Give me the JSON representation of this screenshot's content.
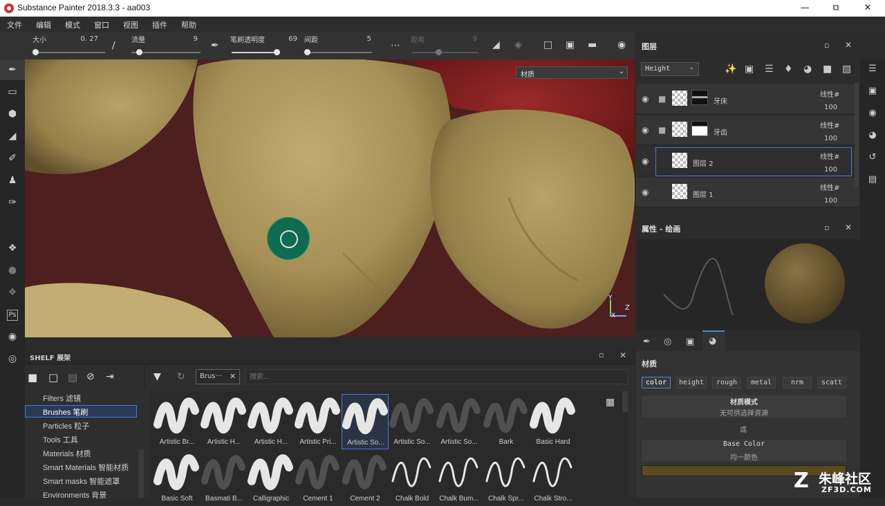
{
  "app": {
    "title": "Substance Painter 2018.3.3 - aa003",
    "window_controls": [
      "minimize-icon",
      "restore-icon",
      "close-icon"
    ]
  },
  "menu": [
    "文件",
    "编辑",
    "模式",
    "窗口",
    "视图",
    "插件",
    "帮助"
  ],
  "toolbar": {
    "size_label": "大小",
    "size_value": "0. 27",
    "flow_label": "流量",
    "flow_value": "9",
    "stroke_opacity_label": "笔刷透明度",
    "stroke_opacity_value": "69",
    "spacing_label": "间距",
    "spacing_value": "5",
    "distance_label": "距离",
    "distance_value": "9"
  },
  "viewport": {
    "material_select": "材质"
  },
  "shelf": {
    "title": "SHELF 展架",
    "filter_tag": "Brus···",
    "search_placeholder": "搜索...",
    "categories": [
      "Filters 滤镜",
      "Brushes 笔刷",
      "Particles 粒子",
      "Tools 工具",
      "Materials 材质",
      "Smart Materials 智能材质",
      "Smart masks 智能遮罩",
      "Environments 背景"
    ],
    "selected_category": "Brushes 笔刷",
    "brushes_row1": [
      "Artistic Br...",
      "Artistic H...",
      "Artistic H...",
      "Artistic Pri...",
      "Artistic So...",
      "Artistic So...",
      "Artistic So...",
      "Bark",
      "Basic Hard"
    ],
    "brushes_row2": [
      "Basic Soft",
      "Basmati B...",
      "Calligraphic",
      "Cement 1",
      "Cement 2",
      "Chalk Bold",
      "Chalk Bum...",
      "Chalk Spr...",
      "Chalk Stro..."
    ]
  },
  "layers": {
    "title": "图层",
    "channel_select": "Height",
    "rows": [
      {
        "name": "牙床",
        "blend": "线性#",
        "opacity": "100"
      },
      {
        "name": "牙齿",
        "blend": "线性#",
        "opacity": "100"
      },
      {
        "name": "图层 2",
        "blend": "线性#",
        "opacity": "100"
      },
      {
        "name": "图层 1",
        "blend": "线性#",
        "opacity": "100"
      }
    ]
  },
  "properties": {
    "title": "属性 - 绘画",
    "section_title": "材质",
    "channels": [
      "color",
      "height",
      "rough",
      "metal",
      "nrm",
      "scatt"
    ],
    "active_channel": "color",
    "material_mode_title": "材质模式",
    "material_mode_value": "无可供选择资源",
    "or_label": "或",
    "base_color_title": "Base Color",
    "base_color_value": "均一颜色",
    "base_color_swatch": "#5a4a1e"
  },
  "watermark": {
    "text": "朱峰社区",
    "url": "ZF3D.COM"
  }
}
